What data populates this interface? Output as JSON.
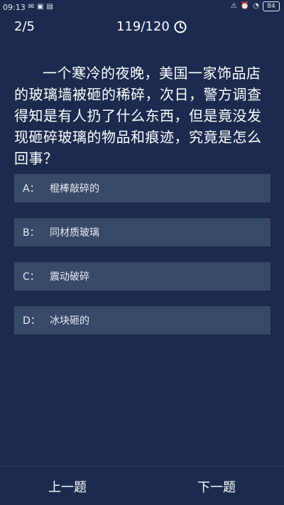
{
  "status_bar": {
    "time": "09:13",
    "left_icons": [
      "mail-icon",
      "image-icon",
      "sim-icon"
    ],
    "right_icons": [
      "warning-icon",
      "alarm-icon",
      "wifi-icon"
    ],
    "battery": "84"
  },
  "header": {
    "progress": "2/5",
    "timer": "119/120",
    "timer_icon": "clock-icon"
  },
  "question": {
    "text": "一个寒冷的夜晚，美国一家饰品店的玻璃墙被砸的稀碎，次日，警方调查得知是有人扔了什么东西，但是竟没发现砸碎玻璃的物品和痕迹，究竟是怎么回事？"
  },
  "options": [
    {
      "letter": "A：",
      "text": "棍棒敲碎的"
    },
    {
      "letter": "B：",
      "text": "同材质玻璃"
    },
    {
      "letter": "C：",
      "text": "震动破碎"
    },
    {
      "letter": "D：",
      "text": "冰块砸的"
    }
  ],
  "navigation": {
    "prev_label": "上一题",
    "next_label": "下一题"
  },
  "colors": {
    "background": "#1b2a4e",
    "option_background": "#384868",
    "text": "#ffffff"
  }
}
